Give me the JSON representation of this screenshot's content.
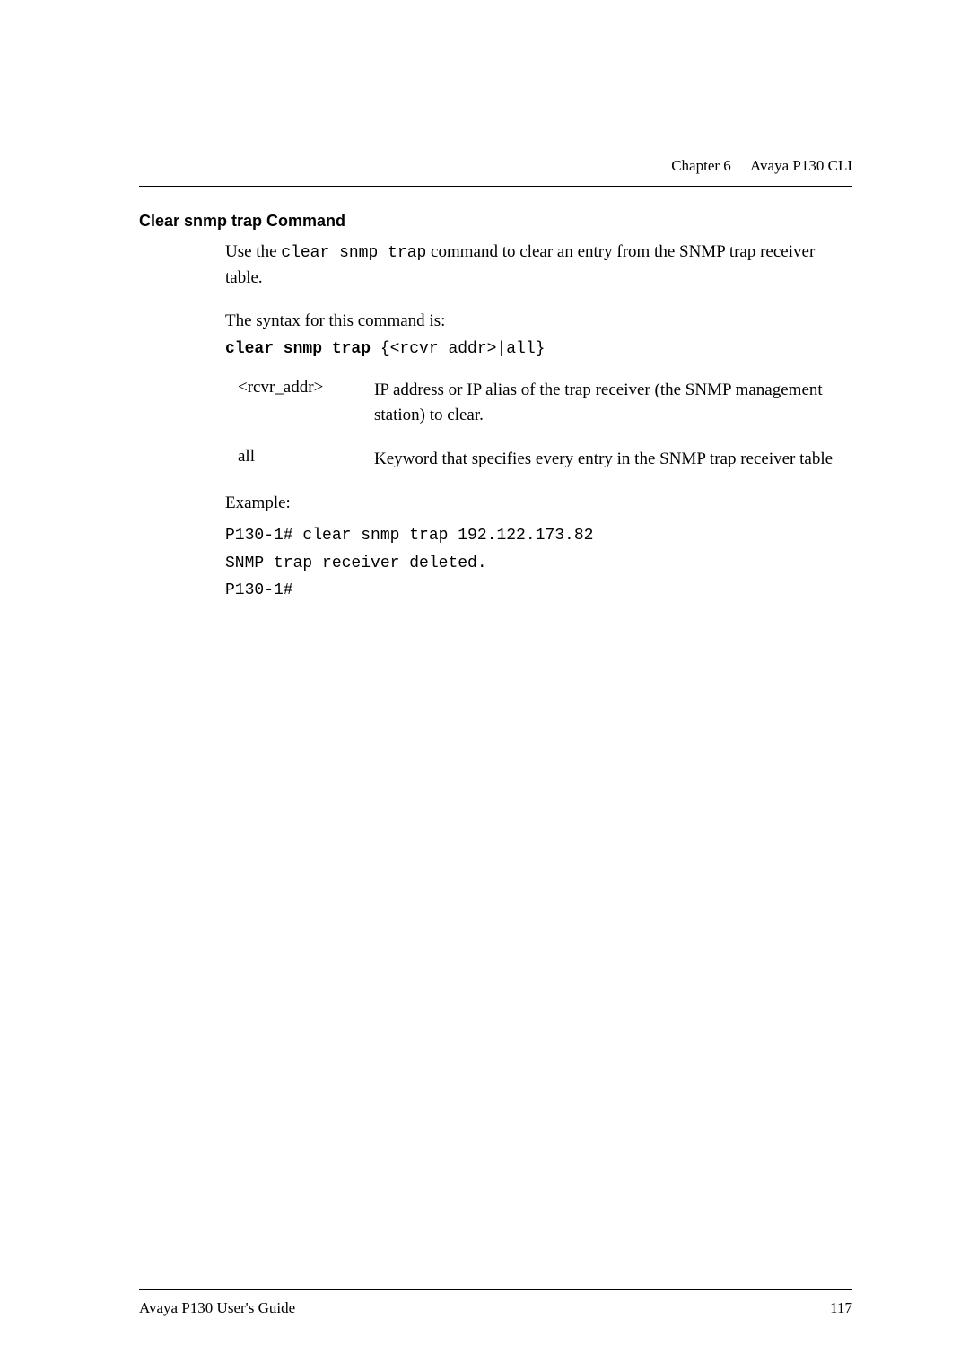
{
  "header": {
    "chapter": "Chapter 6",
    "title": "Avaya P130 CLI"
  },
  "section": {
    "heading": "Clear snmp trap Command",
    "intro_prefix": "Use the ",
    "intro_code": "clear snmp trap",
    "intro_suffix": " command to clear an entry from the SNMP trap receiver table.",
    "syntax_label": "The syntax for this command is:",
    "syntax_bold": "clear snmp trap ",
    "syntax_args": "{<rcvr_addr>|all}",
    "params": [
      {
        "name": "<rcvr_addr>",
        "desc": "IP address or IP alias of the trap receiver (the SNMP management station) to clear."
      },
      {
        "name": "all",
        "desc": "Keyword that specifies every entry in the SNMP trap receiver table"
      }
    ],
    "example_label": "Example:",
    "example_lines": [
      "P130-1# clear snmp trap 192.122.173.82",
      "SNMP trap receiver deleted.",
      "P130-1#"
    ]
  },
  "footer": {
    "guide": "Avaya P130 User's Guide",
    "page": "117"
  }
}
